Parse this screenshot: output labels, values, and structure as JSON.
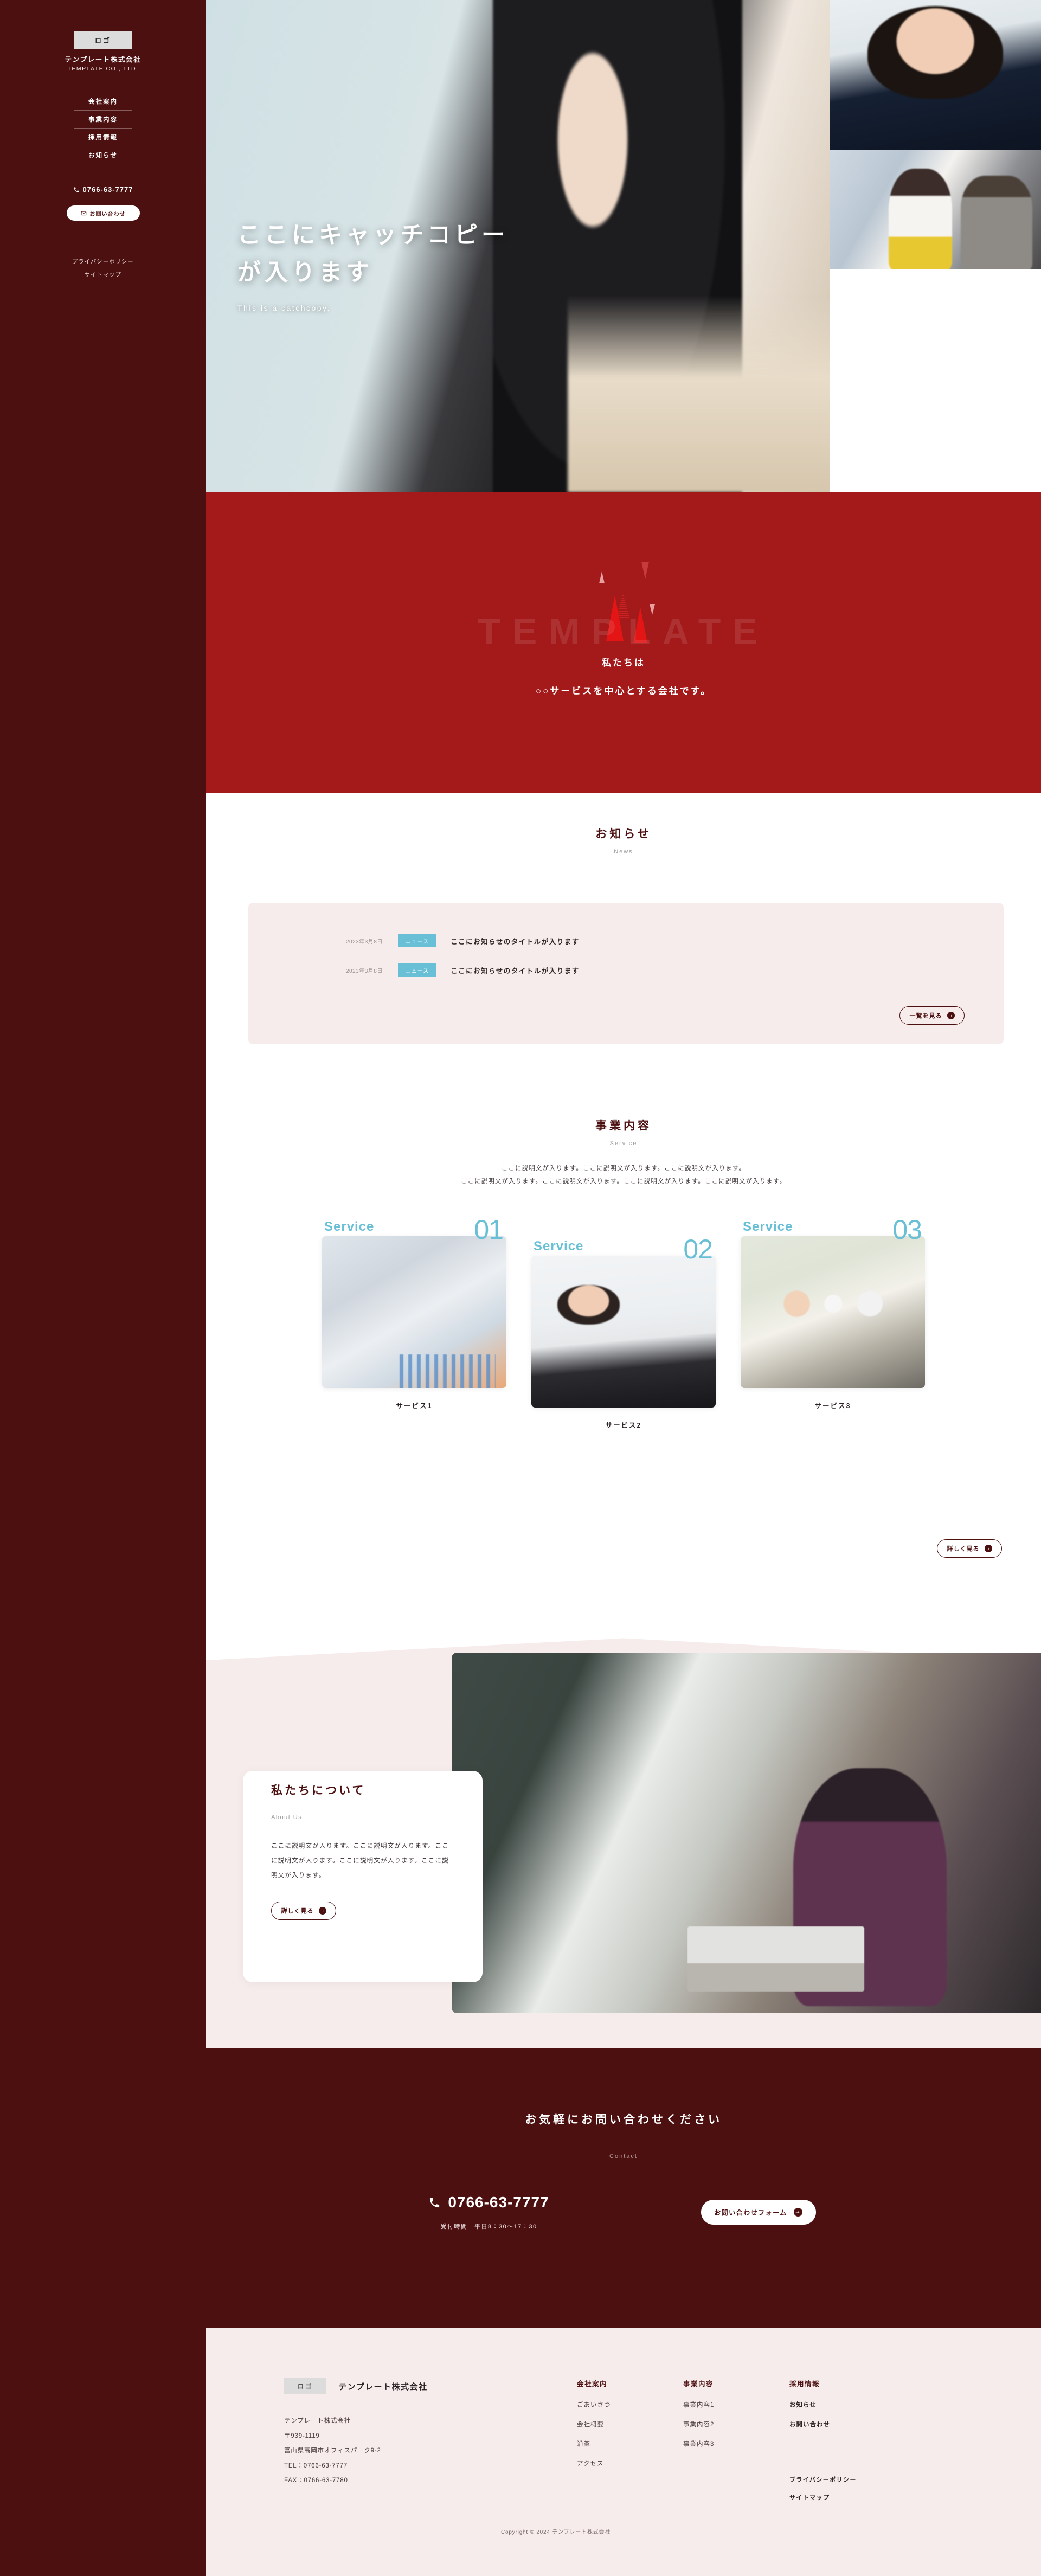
{
  "sidebar": {
    "logo_label": "ロゴ",
    "brand_jp": "テンプレート株式会社",
    "brand_en": "TEMPLATE CO., LTD.",
    "nav": [
      {
        "label": "会社案内"
      },
      {
        "label": "事業内容"
      },
      {
        "label": "採用情報"
      },
      {
        "label": "お知らせ"
      }
    ],
    "tel": "0766-63-7777",
    "contact_button": "お問い合わせ",
    "links": [
      {
        "label": "プライバシーポリシー"
      },
      {
        "label": "サイトマップ"
      }
    ]
  },
  "hero": {
    "headline_line1": "ここにキャッチコピー",
    "headline_line2": "が入ります",
    "subcopy": "This is a catchcopy."
  },
  "band": {
    "watermark": "TEMPLATE",
    "line1": "私たちは",
    "line2": "○○サービスを中心とする会社です。"
  },
  "news": {
    "title_jp": "お知らせ",
    "title_en": "News",
    "items": [
      {
        "date": "2023年3月8日",
        "tag": "ニュース",
        "title": "ここにお知らせのタイトルが入ります"
      },
      {
        "date": "2023年3月8日",
        "tag": "ニュース",
        "title": "ここにお知らせのタイトルが入ります"
      }
    ],
    "more_label": "一覧を見る"
  },
  "service": {
    "title_jp": "事業内容",
    "title_en": "Service",
    "desc_line1": "ここに説明文が入ります。ここに説明文が入ります。ここに説明文が入ります。",
    "desc_line2": "ここに説明文が入ります。ここに説明文が入ります。ここに説明文が入ります。ここに説明文が入ります。",
    "cards": [
      {
        "label": "Service",
        "number": "01",
        "name": "サービス1"
      },
      {
        "label": "Service",
        "number": "02",
        "name": "サービス2"
      },
      {
        "label": "Service",
        "number": "03",
        "name": "サービス3"
      }
    ],
    "more_label": "詳しく見る"
  },
  "about": {
    "title_jp": "私たちについて",
    "title_en": "About Us",
    "body": "ここに説明文が入ります。ここに説明文が入ります。ここに説明文が入ります。ここに説明文が入ります。ここに説明文が入ります。",
    "more_label": "詳しく見る"
  },
  "contact": {
    "title_jp": "お気軽にお問い合わせください",
    "title_en": "Contact",
    "tel": "0766-63-7777",
    "hours": "受付時間　平日8：30〜17：30",
    "form_button": "お問い合わせフォーム"
  },
  "footer": {
    "logo_label": "ロゴ",
    "company_name": "テンプレート株式会社",
    "address_line1": "テンプレート株式会社",
    "address_line2": "〒939-1119",
    "address_line3": "富山県高岡市オフィスパーク9-2",
    "address_line4": "TEL：0766-63-7777",
    "address_line5": "FAX：0766-63-7780",
    "columns": [
      {
        "heading": "会社案内",
        "links": [
          {
            "label": "ごあいさつ"
          },
          {
            "label": "会社概要"
          },
          {
            "label": "沿革"
          },
          {
            "label": "アクセス"
          }
        ]
      },
      {
        "heading": "事業内容",
        "links": [
          {
            "label": "事業内容1"
          },
          {
            "label": "事業内容2"
          },
          {
            "label": "事業内容3"
          }
        ]
      },
      {
        "heading": "採用情報",
        "links": [
          {
            "label": "お知らせ"
          },
          {
            "label": "お問い合わせ"
          }
        ]
      }
    ],
    "sub_links": [
      {
        "label": "プライバシーポリシー"
      },
      {
        "label": "サイトマップ"
      }
    ],
    "copyright": "Copyright © 2024 テンプレート株式会社"
  },
  "colors": {
    "dark_red": "#4d1010",
    "bright_red": "#a41a1a",
    "pink": "#f7ecec",
    "cyan": "#69c0d6"
  }
}
